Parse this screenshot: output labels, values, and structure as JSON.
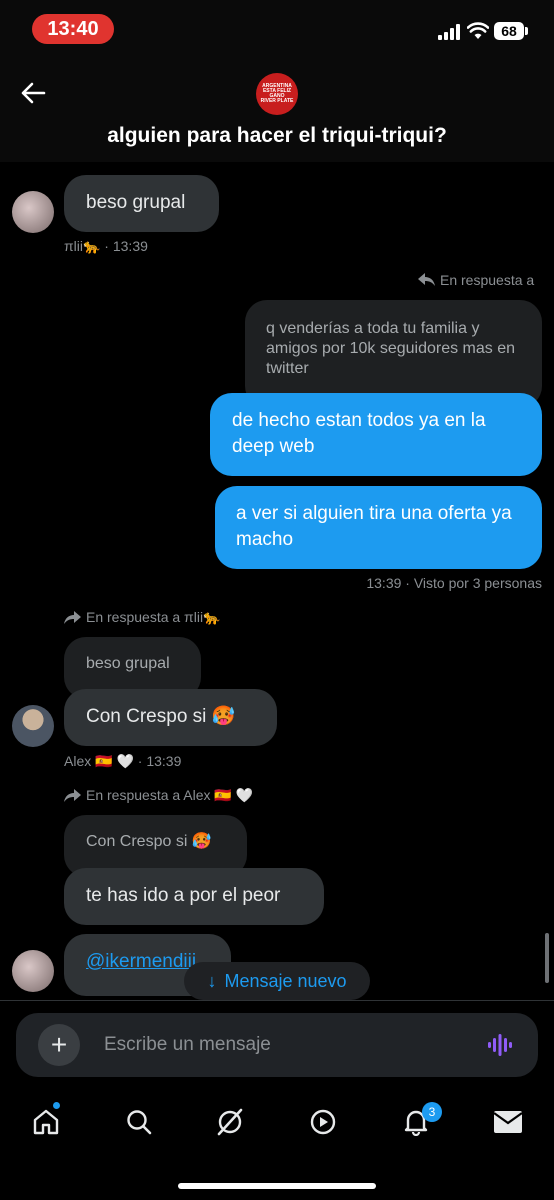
{
  "status_bar": {
    "time": "13:40",
    "battery": "68"
  },
  "header": {
    "title": "alguien para hacer el triqui-triqui?",
    "avatar_text": [
      "ARGENTINA",
      "ESTA FELIZ",
      "GANO",
      "RIVER PLATE"
    ]
  },
  "messages": {
    "m1_text": "beso grupal",
    "m1_meta": "πlii🐆 · 13:39",
    "reply_tag_1": "En respuesta a",
    "quote_1": "q venderías a toda tu familia y amigos por 10k seguidores mas en twitter",
    "m2_text": "de hecho estan todos ya en la deep web",
    "m3_text": "a ver si alguien tira una oferta ya macho",
    "m3_meta": "13:39 · Visto por 3 personas",
    "reply_tag_2": "En respuesta a πlii🐆",
    "quote_2": "beso grupal",
    "m4_text": "Con Crespo si 🥵",
    "m4_meta": "Alex 🇪🇸 🤍 · 13:39",
    "reply_tag_3": "En respuesta a Alex 🇪🇸 🤍",
    "quote_3": "Con Crespo si 🥵",
    "m5_text": "te has ido a por el peor",
    "m6_text": "@ikermendiii"
  },
  "new_message_pill": "Mensaje nuevo",
  "composer": {
    "placeholder": "Escribe un mensaje"
  },
  "nav": {
    "notifications_badge": "3"
  },
  "colors": {
    "accent": "#1d9bf0",
    "bubble_in": "#2f3336",
    "status_pill": "#e0342f"
  }
}
